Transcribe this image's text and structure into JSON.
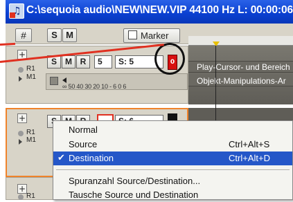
{
  "window": {
    "title": "C:\\sequoia audio\\NEW\\NEW.VIP   44100 Hz L: 00:00:06 *"
  },
  "toolbar": {
    "grid_icon": "#",
    "s_label": "S",
    "m_label": "M",
    "marker_label": "Marker"
  },
  "track1": {
    "plus": "+",
    "r_label": "R1",
    "m_label": "M1",
    "buttons": {
      "s": "S",
      "m": "M",
      "r": "R",
      "num": "5",
      "s_value": "S: 5"
    },
    "scale": "∞  50 40 30 20  10 - 6   0   6",
    "led": "0",
    "content": {
      "line1": "Play-Cursor- und Bereich",
      "line2": "Objekt-Manipulations-Ar"
    }
  },
  "track2": {
    "plus": "+",
    "r_label": "R1",
    "m_label": "M1",
    "buttons": {
      "s": "S",
      "m": "M",
      "r": "R",
      "s_value": "S: 6"
    }
  },
  "track3": {
    "plus": "+",
    "r_label": "R1"
  },
  "context_menu": {
    "items": [
      {
        "label": "Normal",
        "shortcut": ""
      },
      {
        "label": "Source",
        "shortcut": "Ctrl+Alt+S"
      },
      {
        "label": "Destination",
        "shortcut": "Ctrl+Alt+D",
        "checked": true,
        "check": "✔"
      },
      {
        "label": "Spuranzahl Source/Destination...",
        "shortcut": ""
      },
      {
        "label": "Tausche Source und Destination",
        "shortcut": ""
      }
    ]
  },
  "colors": {
    "titlebar": "#0a3fd0",
    "selection": "#2557c8",
    "highlight_border": "#f0832a",
    "annotation_red": "#e03020"
  }
}
